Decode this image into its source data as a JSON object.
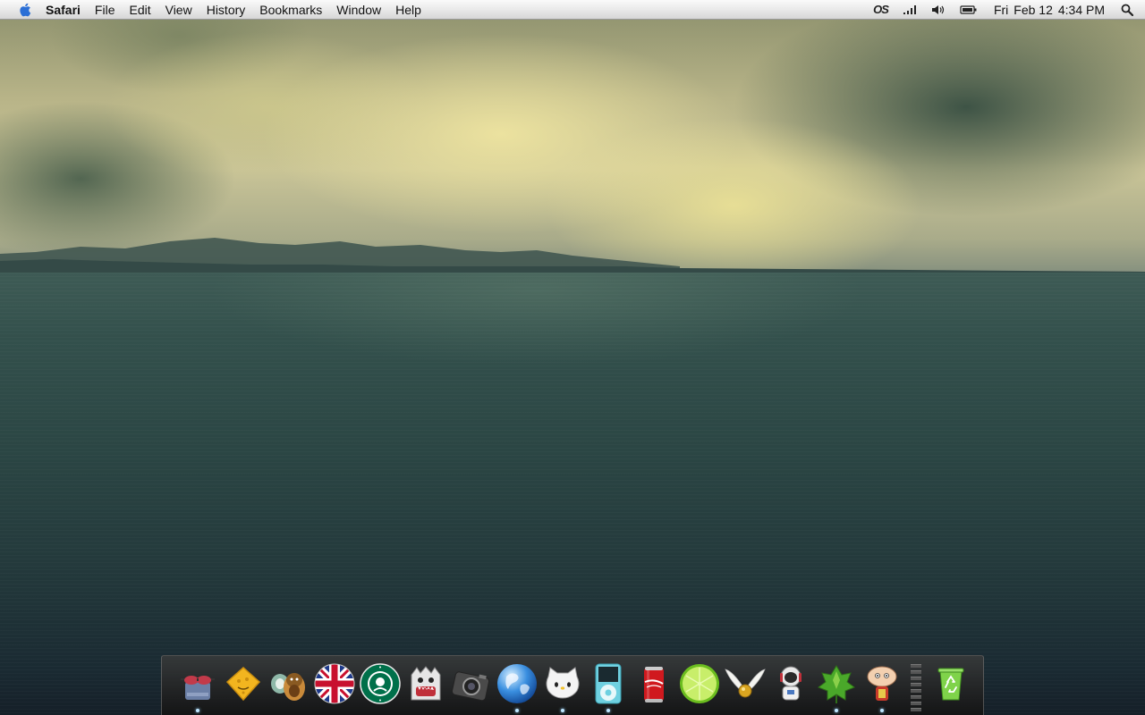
{
  "menubar": {
    "app_name": "Safari",
    "menus": [
      "File",
      "Edit",
      "View",
      "History",
      "Bookmarks",
      "Window",
      "Help"
    ],
    "status": {
      "tray_label": "OS",
      "clock_day": "Fri",
      "clock_date": "Feb 12",
      "clock_time": "4:34 PM"
    }
  },
  "dock": {
    "items": [
      {
        "icon": "sunglasses-robot-icon",
        "running": true
      },
      {
        "icon": "cheese-icon",
        "running": false
      },
      {
        "icon": "monkey-icon",
        "running": false
      },
      {
        "icon": "union-jack-icon",
        "running": false
      },
      {
        "icon": "starbucks-icon",
        "running": false
      },
      {
        "icon": "monster-icon",
        "running": false
      },
      {
        "icon": "camera-icon",
        "running": false
      },
      {
        "icon": "globe-icon",
        "running": true
      },
      {
        "icon": "hello-kitty-icon",
        "running": true
      },
      {
        "icon": "ipod-icon",
        "running": true
      },
      {
        "icon": "cola-can-icon",
        "running": false
      },
      {
        "icon": "lime-icon",
        "running": false
      },
      {
        "icon": "golden-snitch-icon",
        "running": false
      },
      {
        "icon": "astronaut-icon",
        "running": false
      },
      {
        "icon": "artichoke-icon",
        "running": true
      },
      {
        "icon": "stewie-icon",
        "running": true
      }
    ],
    "trash": {
      "icon": "recycle-bin-icon"
    }
  },
  "colors": {
    "run_indicator": "#bfe6ff",
    "menubar_text": "#111111"
  }
}
